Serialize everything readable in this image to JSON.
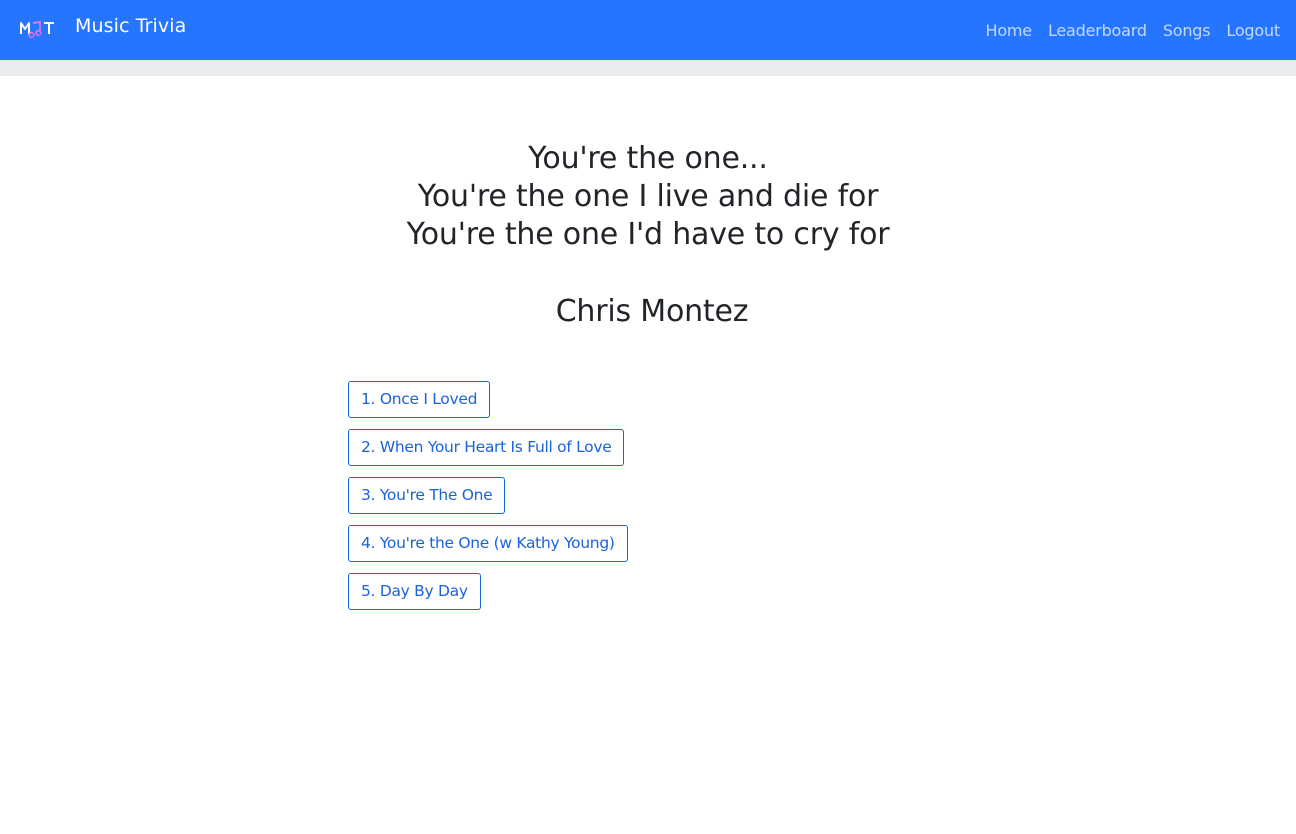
{
  "navbar": {
    "logo_text": "MQT",
    "brand": "Music Trivia",
    "links": [
      {
        "label": "Home"
      },
      {
        "label": "Leaderboard"
      },
      {
        "label": "Songs"
      },
      {
        "label": "Logout"
      }
    ]
  },
  "question": {
    "lyrics": [
      "You're the one...",
      "You're the one I live and die for",
      "You're the one I'd have to cry for"
    ],
    "artist": "Chris Montez"
  },
  "options": [
    {
      "label": "1. Once I Loved"
    },
    {
      "label": "2. When Your Heart Is Full of Love"
    },
    {
      "label": "3. You're The One"
    },
    {
      "label": "4. You're the One (w Kathy Young)"
    },
    {
      "label": "5. Day By Day"
    }
  ],
  "colors": {
    "navbar_bg": "#2575ff",
    "subbar_bg": "#e9ecef",
    "button_accent": "#1a63d8",
    "text": "#212529"
  }
}
